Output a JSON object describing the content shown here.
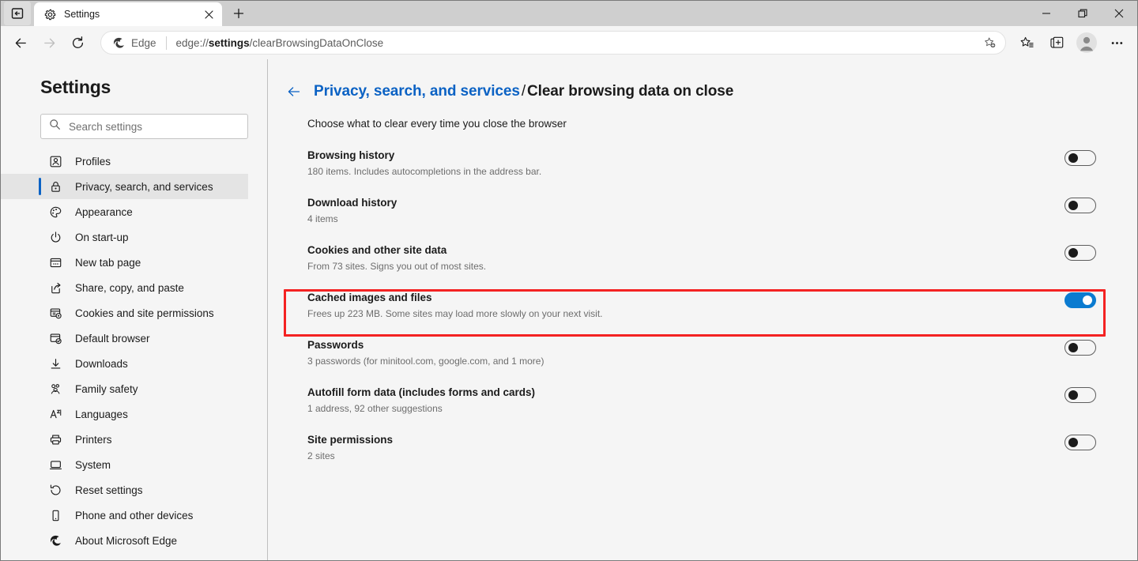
{
  "window": {
    "controls": {
      "minimize": "minimize",
      "restore": "restore",
      "close": "close"
    }
  },
  "tabstrip": {
    "tab_actions_label": "tab-actions",
    "tabs": [
      {
        "title": "Settings",
        "favicon": "gear-icon",
        "active": true
      }
    ],
    "new_tab_label": "+"
  },
  "toolbar": {
    "back_label": "back",
    "forward_label": "forward",
    "refresh_label": "refresh",
    "omnibox": {
      "brand": "Edge",
      "url_prefix": "edge://",
      "url_bold": "settings",
      "url_suffix": "/clearBrowsingDataOnClose",
      "add_favorite_icon": "star-plus-icon"
    },
    "buttons": [
      {
        "name": "favorites-button",
        "icon": "star-list-icon"
      },
      {
        "name": "collections-button",
        "icon": "collections-icon"
      },
      {
        "name": "profile-button",
        "icon": "avatar-icon"
      },
      {
        "name": "settings-and-more-button",
        "icon": "ellipsis-icon"
      }
    ]
  },
  "sidebar": {
    "title": "Settings",
    "search": {
      "placeholder": "Search settings",
      "value": "",
      "icon": "search-icon"
    },
    "items": [
      {
        "label": "Profiles",
        "icon": "profile-icon",
        "selected": false
      },
      {
        "label": "Privacy, search, and services",
        "icon": "lock-icon",
        "selected": true
      },
      {
        "label": "Appearance",
        "icon": "palette-icon",
        "selected": false
      },
      {
        "label": "On start-up",
        "icon": "power-icon",
        "selected": false
      },
      {
        "label": "New tab page",
        "icon": "new-tab-icon",
        "selected": false
      },
      {
        "label": "Share, copy, and paste",
        "icon": "share-icon",
        "selected": false
      },
      {
        "label": "Cookies and site permissions",
        "icon": "cookies-icon",
        "selected": false
      },
      {
        "label": "Default browser",
        "icon": "default-browser-icon",
        "selected": false
      },
      {
        "label": "Downloads",
        "icon": "download-icon",
        "selected": false
      },
      {
        "label": "Family safety",
        "icon": "family-icon",
        "selected": false
      },
      {
        "label": "Languages",
        "icon": "languages-icon",
        "selected": false
      },
      {
        "label": "Printers",
        "icon": "printer-icon",
        "selected": false
      },
      {
        "label": "System",
        "icon": "system-icon",
        "selected": false
      },
      {
        "label": "Reset settings",
        "icon": "reset-icon",
        "selected": false
      },
      {
        "label": "Phone and other devices",
        "icon": "phone-icon",
        "selected": false
      },
      {
        "label": "About Microsoft Edge",
        "icon": "edge-logo-icon",
        "selected": false
      }
    ]
  },
  "main": {
    "breadcrumb": {
      "back_icon": "back-arrow-icon",
      "parent": "Privacy, search, and services",
      "separator": "/",
      "current": "Clear browsing data on close"
    },
    "subtitle": "Choose what to clear every time you close the browser",
    "rows": [
      {
        "title": "Browsing history",
        "desc": "180 items. Includes autocompletions in the address bar.",
        "toggle": "off",
        "highlighted": false
      },
      {
        "title": "Download history",
        "desc": "4 items",
        "toggle": "off",
        "highlighted": false
      },
      {
        "title": "Cookies and other site data",
        "desc": "From 73 sites. Signs you out of most sites.",
        "toggle": "off",
        "highlighted": false
      },
      {
        "title": "Cached images and files",
        "desc": "Frees up 223 MB. Some sites may load more slowly on your next visit.",
        "toggle": "on",
        "highlighted": true
      },
      {
        "title": "Passwords",
        "desc": "3 passwords (for minitool.com, google.com, and 1 more)",
        "toggle": "off",
        "highlighted": false
      },
      {
        "title": "Autofill form data (includes forms and cards)",
        "desc": "1 address, 92 other suggestions",
        "toggle": "off",
        "highlighted": false
      },
      {
        "title": "Site permissions",
        "desc": "2 sites",
        "toggle": "off",
        "highlighted": false
      }
    ]
  },
  "colors": {
    "accent_blue": "#0b7bd0",
    "link_blue": "#0b62c4",
    "annotation_red": "#f42222",
    "chrome_bg": "#f5f5f5",
    "tabstrip_bg": "#cfcfcf"
  }
}
